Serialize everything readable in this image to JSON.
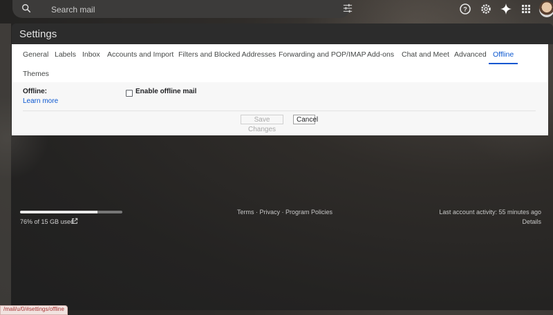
{
  "search": {
    "placeholder": "Search mail"
  },
  "settings": {
    "title": "Settings",
    "tabs": [
      {
        "label": "General"
      },
      {
        "label": "Labels"
      },
      {
        "label": "Inbox"
      },
      {
        "label": "Accounts and Import"
      },
      {
        "label": "Filters and Blocked Addresses"
      },
      {
        "label": "Forwarding and POP/IMAP"
      },
      {
        "label": "Add-ons"
      },
      {
        "label": "Chat and Meet"
      },
      {
        "label": "Advanced"
      },
      {
        "label": "Offline",
        "active": true
      },
      {
        "label": "Themes"
      }
    ],
    "offline": {
      "section_label": "Offline:",
      "learn_more": "Learn more",
      "checkbox_label": "Enable offline mail",
      "checked": false
    },
    "buttons": {
      "save": "Save Changes",
      "cancel": "Cancel"
    }
  },
  "footer": {
    "storage_text": "76% of 15 GB used",
    "storage_fraction": 0.76,
    "links": [
      "Terms",
      "Privacy",
      "Program Policies"
    ],
    "link_separator": " · ",
    "last_activity": "Last account activity: 55 minutes ago",
    "details": "Details"
  },
  "status_bar": {
    "url": "/mail/u/0/#settings/offline"
  },
  "colors": {
    "accent": "#0b57d0",
    "background": "#242322"
  }
}
